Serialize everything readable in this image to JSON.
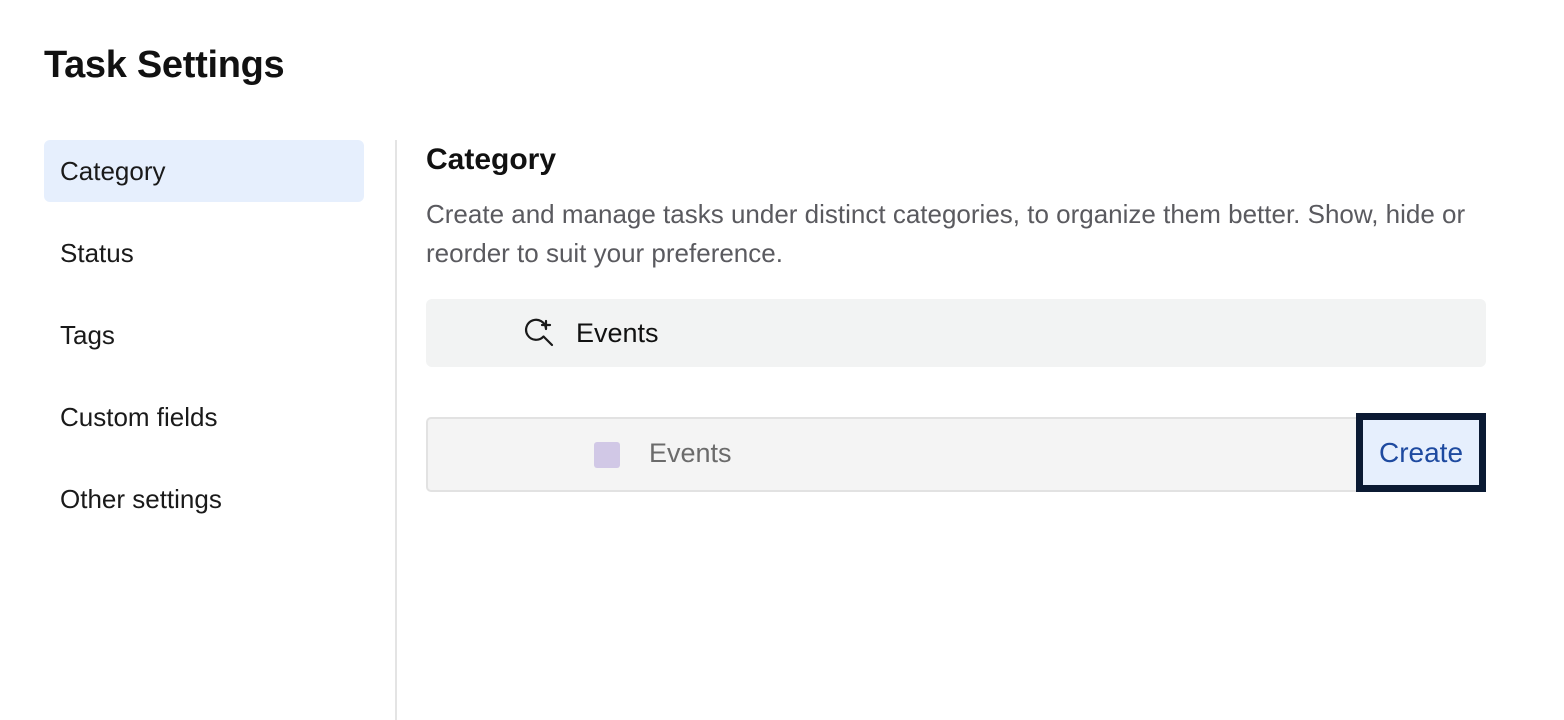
{
  "page": {
    "title": "Task Settings"
  },
  "sidebar": {
    "items": [
      {
        "label": "Category",
        "active": true
      },
      {
        "label": "Status",
        "active": false
      },
      {
        "label": "Tags",
        "active": false
      },
      {
        "label": "Custom fields",
        "active": false
      },
      {
        "label": "Other settings",
        "active": false
      }
    ]
  },
  "main": {
    "section_title": "Category",
    "description": "Create and manage tasks under distinct categories, to organize them better. Show, hide or reorder to suit your preference.",
    "search": {
      "icon": "search-add-icon",
      "value": "Events"
    },
    "create_row": {
      "swatch_color": "#d1c8e6",
      "label": "Events",
      "button_label": "Create"
    }
  },
  "colors": {
    "active_bg": "#e6effd",
    "button_text": "#1e4aa0",
    "focus_border": "#0b1a33"
  }
}
